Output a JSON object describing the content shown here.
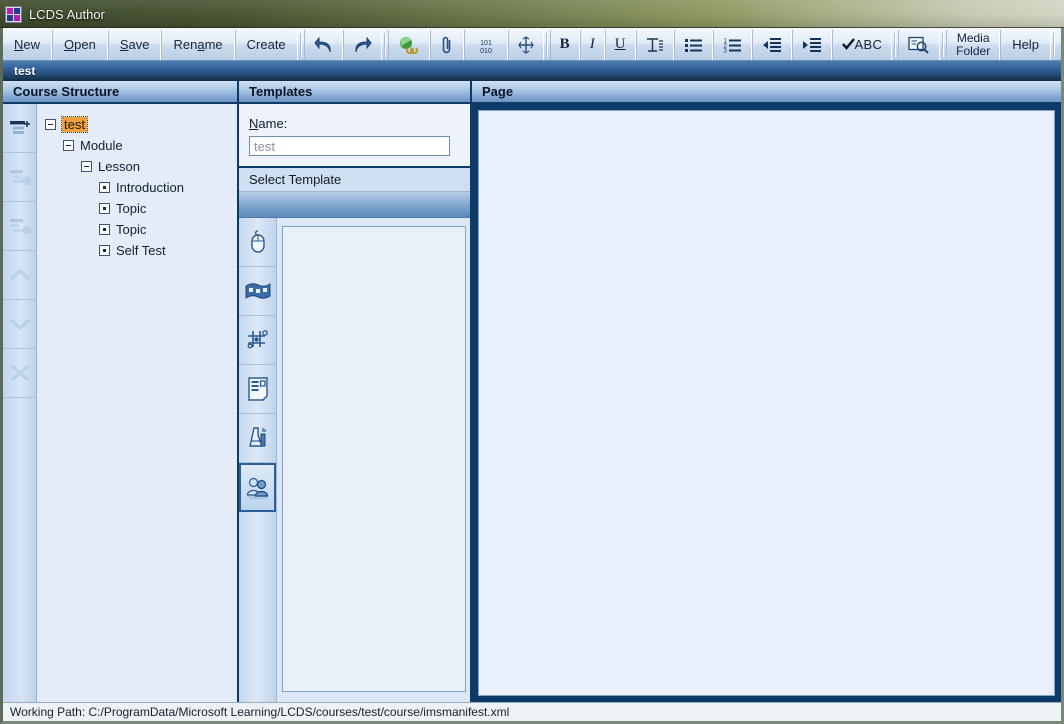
{
  "window": {
    "title": "LCDS Author",
    "icon": "app-grid-icon"
  },
  "toolbar": {
    "buttons": [
      {
        "label": "New",
        "accel": "N",
        "type": "text",
        "name": "new-button"
      },
      {
        "label": "Open",
        "accel": "O",
        "type": "text",
        "name": "open-button"
      },
      {
        "label": "Save",
        "accel": "S",
        "type": "text",
        "name": "save-button"
      },
      {
        "label": "Rename",
        "accel": "a",
        "type": "text",
        "name": "rename-button"
      },
      {
        "label": "Create",
        "accel": "",
        "type": "text",
        "name": "create-button"
      }
    ],
    "icons": [
      {
        "name": "undo-icon",
        "title": "Undo"
      },
      {
        "name": "redo-icon",
        "title": "Redo"
      },
      {
        "name": "hyperlink-icon",
        "title": "Insert Hyperlink"
      },
      {
        "name": "attachment-icon",
        "title": "Attach File"
      },
      {
        "name": "source-code-icon",
        "title": "Source Code",
        "text": "101 010"
      },
      {
        "name": "insert-symbol-icon",
        "title": "Insert Special Character"
      },
      {
        "name": "bold-icon",
        "title": "Bold",
        "text": "B"
      },
      {
        "name": "italic-icon",
        "title": "Italic",
        "text": "I"
      },
      {
        "name": "underline-icon",
        "title": "Underline",
        "text": "U"
      },
      {
        "name": "heading-icon",
        "title": "Heading",
        "text": "H"
      },
      {
        "name": "bulleted-list-icon",
        "title": "Bulleted List"
      },
      {
        "name": "numbered-list-icon",
        "title": "Numbered List"
      },
      {
        "name": "decrease-indent-icon",
        "title": "Decrease Indent"
      },
      {
        "name": "increase-indent-icon",
        "title": "Increase Indent"
      },
      {
        "name": "spellcheck-icon",
        "title": "Spelling",
        "text": "ABC"
      },
      {
        "name": "preview-icon",
        "title": "Preview"
      }
    ],
    "media_folder_label_line1": "Media",
    "media_folder_label_line2": "Folder",
    "help_label": "Help"
  },
  "document_tab": {
    "label": "test"
  },
  "panes": {
    "course_structure": {
      "header": "Course Structure",
      "vertical_toolbar": [
        {
          "name": "add-module-button",
          "enabled": true
        },
        {
          "name": "add-lesson-button",
          "enabled": false
        },
        {
          "name": "add-topic-button",
          "enabled": false
        },
        {
          "name": "move-up-button",
          "enabled": false
        },
        {
          "name": "move-down-button",
          "enabled": false
        },
        {
          "name": "delete-button",
          "enabled": false
        }
      ],
      "tree": [
        {
          "label": "test",
          "depth": 0,
          "marker": "minus",
          "selected": true
        },
        {
          "label": "Module",
          "depth": 1,
          "marker": "minus",
          "selected": false
        },
        {
          "label": "Lesson",
          "depth": 2,
          "marker": "minus",
          "selected": false
        },
        {
          "label": "Introduction",
          "depth": 3,
          "marker": "dot",
          "selected": false
        },
        {
          "label": "Topic",
          "depth": 3,
          "marker": "dot",
          "selected": false
        },
        {
          "label": "Topic",
          "depth": 3,
          "marker": "dot",
          "selected": false
        },
        {
          "label": "Self Test",
          "depth": 3,
          "marker": "dot",
          "selected": false
        }
      ]
    },
    "templates": {
      "header": "Templates",
      "name_label": "Name:",
      "name_accel": "N",
      "name_value": "",
      "name_placeholder": "test",
      "select_template_label": "Select Template",
      "categories": [
        {
          "name": "template-category-interact-icon",
          "label": "Interact",
          "selected": false
        },
        {
          "name": "template-category-media-icon",
          "label": "Media",
          "selected": false
        },
        {
          "name": "template-category-games-icon",
          "label": "Games",
          "selected": false
        },
        {
          "name": "template-category-text-icon",
          "label": "Text",
          "selected": false
        },
        {
          "name": "template-category-labs-icon",
          "label": "Labs",
          "selected": false
        },
        {
          "name": "template-category-collaborate-icon",
          "label": "Collaborate",
          "selected": true
        }
      ]
    },
    "page": {
      "header": "Page"
    }
  },
  "statusbar": {
    "text": "Working Path: C:/ProgramData/Microsoft Learning/LCDS/courses/test/course/imsmanifest.xml"
  },
  "colors": {
    "pane_border": "#0d3a66",
    "header_blue": "#86a9d2",
    "selection_orange": "#f0a03c",
    "canvas": "#eaf0fb"
  }
}
